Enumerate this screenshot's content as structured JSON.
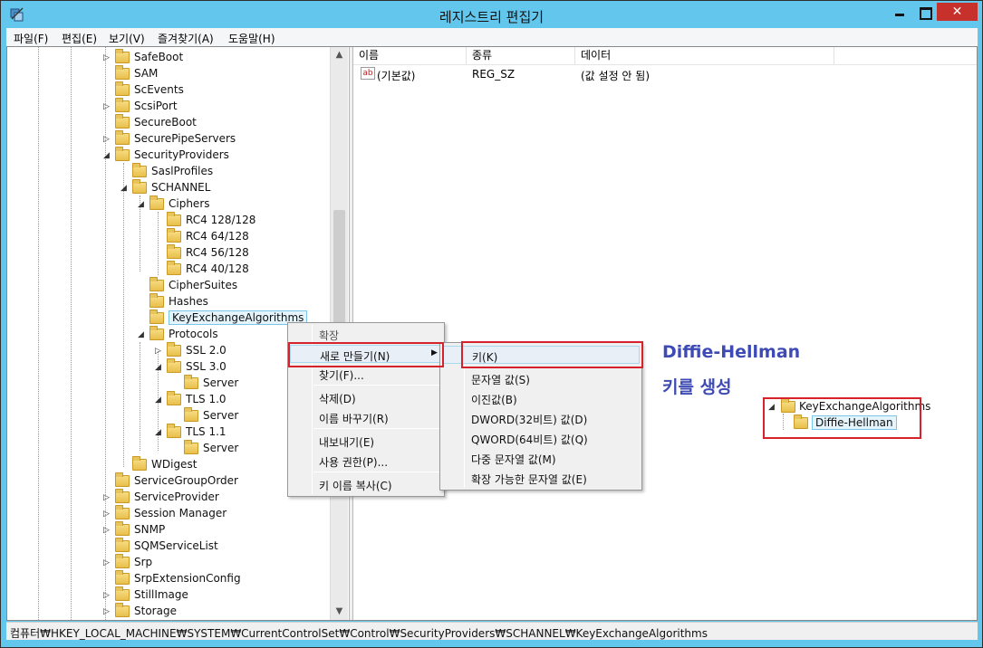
{
  "window": {
    "title": "레지스트리 편집기",
    "close_glyph": "✕"
  },
  "menu": [
    "파일(F)",
    "편집(E)",
    "보기(V)",
    "즐겨찾기(A)",
    "도움말(H)"
  ],
  "tree": [
    {
      "label": "SafeBoot",
      "expander": "▷"
    },
    {
      "label": "SAM",
      "expander": ""
    },
    {
      "label": "ScEvents",
      "expander": ""
    },
    {
      "label": "ScsiPort",
      "expander": "▷"
    },
    {
      "label": "SecureBoot",
      "expander": ""
    },
    {
      "label": "SecurePipeServers",
      "expander": "▷"
    },
    {
      "label": "SecurityProviders",
      "expander": "◢"
    },
    {
      "label": "SaslProfiles",
      "expander": ""
    },
    {
      "label": "SCHANNEL",
      "expander": "◢"
    },
    {
      "label": "Ciphers",
      "expander": "◢"
    },
    {
      "label": "RC4 128/128",
      "expander": ""
    },
    {
      "label": "RC4 64/128",
      "expander": ""
    },
    {
      "label": "RC4 56/128",
      "expander": ""
    },
    {
      "label": "RC4 40/128",
      "expander": ""
    },
    {
      "label": "CipherSuites",
      "expander": ""
    },
    {
      "label": "Hashes",
      "expander": ""
    },
    {
      "label": "KeyExchangeAlgorithms",
      "expander": ""
    },
    {
      "label": "Protocols",
      "expander": "◢"
    },
    {
      "label": "SSL 2.0",
      "expander": "▷"
    },
    {
      "label": "SSL 3.0",
      "expander": "◢"
    },
    {
      "label": "Server",
      "expander": ""
    },
    {
      "label": "TLS 1.0",
      "expander": "◢"
    },
    {
      "label": "Server",
      "expander": ""
    },
    {
      "label": "TLS 1.1",
      "expander": "◢"
    },
    {
      "label": "Server",
      "expander": ""
    },
    {
      "label": "WDigest",
      "expander": ""
    },
    {
      "label": "ServiceGroupOrder",
      "expander": ""
    },
    {
      "label": "ServiceProvider",
      "expander": "▷"
    },
    {
      "label": "Session Manager",
      "expander": "▷"
    },
    {
      "label": "SNMP",
      "expander": "▷"
    },
    {
      "label": "SQMServiceList",
      "expander": ""
    },
    {
      "label": "Srp",
      "expander": "▷"
    },
    {
      "label": "SrpExtensionConfig",
      "expander": ""
    },
    {
      "label": "StillImage",
      "expander": "▷"
    },
    {
      "label": "Storage",
      "expander": "▷"
    }
  ],
  "list": {
    "headers": [
      "이름",
      "종류",
      "데이터"
    ],
    "rows": [
      {
        "icon": "ab",
        "name": "(기본값)",
        "type": "REG_SZ",
        "data": "(값 설정 안 됨)"
      }
    ]
  },
  "context_menu": {
    "items": [
      "확장",
      "새로 만들기(N)",
      "찾기(F)...",
      "삭제(D)",
      "이름 바꾸기(R)",
      "내보내기(E)",
      "사용 권한(P)...",
      "키 이름 복사(C)"
    ]
  },
  "submenu": {
    "items": [
      "키(K)",
      "문자열 값(S)",
      "이진값(B)",
      "DWORD(32비트) 값(D)",
      "QWORD(64비트) 값(Q)",
      "다중 문자열 값(M)",
      "확장 가능한 문자열 값(E)"
    ]
  },
  "annotation": {
    "line1": "Diffie-Hellman",
    "line2": "키를 생성",
    "color": "#3e4bb4"
  },
  "mini_tree": {
    "parent": "KeyExchangeAlgorithms",
    "parent_expander": "◢",
    "child": "Diffie-Hellman"
  },
  "status": {
    "path": "컴퓨터₩HKEY_LOCAL_MACHINE₩SYSTEM₩CurrentControlSet₩Control₩SecurityProviders₩SCHANNEL₩KeyExchangeAlgorithms"
  },
  "scrollbar": {
    "up": "▲",
    "down": "▼"
  },
  "colors": {
    "titlebar": "#63c7ed",
    "highlight_box": "#d6232b",
    "close_button": "#c7312b"
  }
}
